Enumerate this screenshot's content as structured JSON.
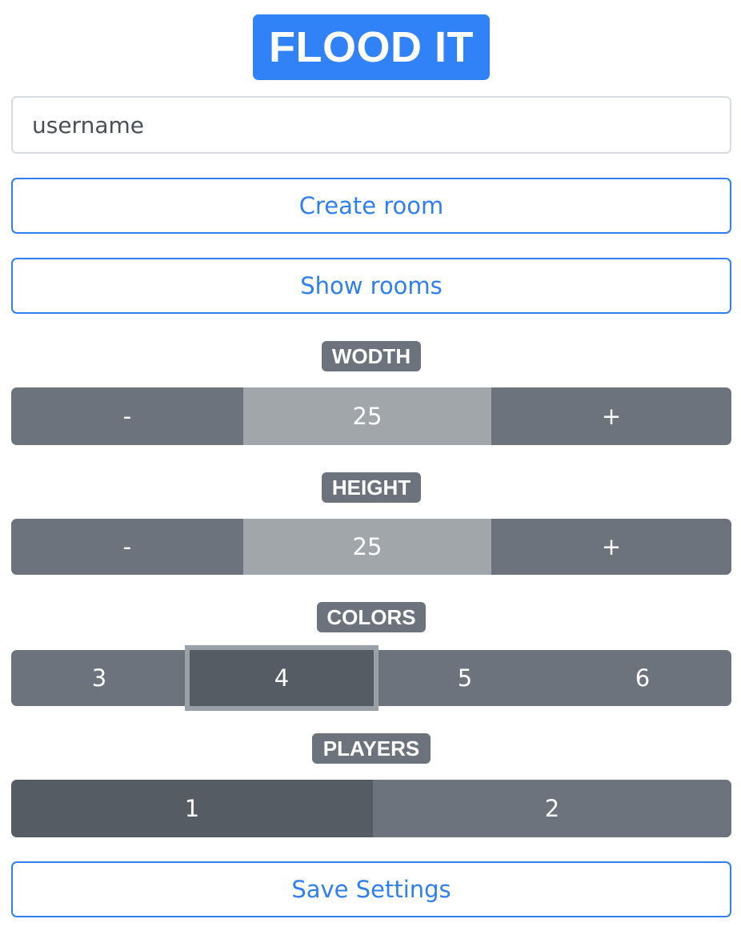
{
  "app": {
    "title": "FLOOD IT"
  },
  "username": {
    "placeholder": "username",
    "value": ""
  },
  "buttons": {
    "create_room": "Create room",
    "show_rooms": "Show rooms",
    "save_settings": "Save Settings"
  },
  "width": {
    "label": "WODTH",
    "decrement": "-",
    "value": "25",
    "increment": "+"
  },
  "height": {
    "label": "HEIGHT",
    "decrement": "-",
    "value": "25",
    "increment": "+"
  },
  "colors": {
    "label": "COLORS",
    "options": [
      "3",
      "4",
      "5",
      "6"
    ],
    "selected": "4"
  },
  "players": {
    "label": "PLAYERS",
    "options": [
      "1",
      "2"
    ],
    "selected": "1"
  },
  "theme": {
    "primary": "#3182f6",
    "secondary": "#6c737c",
    "secondary_dark": "#565c64",
    "value_bg": "#a1a6aa"
  }
}
